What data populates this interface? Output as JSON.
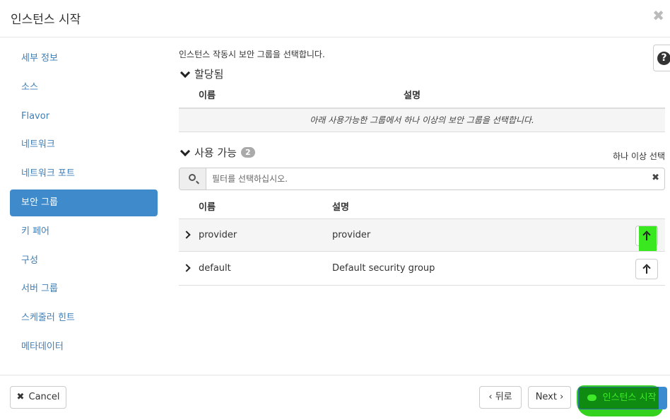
{
  "modal": {
    "title": "인스턴스 시작",
    "close_glyph": "✖"
  },
  "sidebar": {
    "items": [
      {
        "label": "세부 정보"
      },
      {
        "label": "소스"
      },
      {
        "label": "Flavor"
      },
      {
        "label": "네트워크"
      },
      {
        "label": "네트워크 포트"
      },
      {
        "label": "보안 그룹",
        "active": true
      },
      {
        "label": "키 페어"
      },
      {
        "label": "구성"
      },
      {
        "label": "서버 그룹"
      },
      {
        "label": "스케줄러 힌트"
      },
      {
        "label": "메타데이터"
      }
    ]
  },
  "help": {
    "glyph": "?"
  },
  "main": {
    "description": "인스턴스 작동시 보안 그룹을 선택합니다.",
    "allocated": {
      "title": "할당됨",
      "col_name": "이름",
      "col_desc": "설명",
      "empty_text": "아래 사용가능한 그룹에서 하나 이상의 보안 그룹을 선택합니다."
    },
    "available": {
      "title": "사용 가능",
      "count": "2",
      "select_hint": "하나 이상 선택",
      "filter_placeholder": "필터를 선택하십시오.",
      "clear_glyph": "✖",
      "col_name": "이름",
      "col_desc": "설명",
      "rows": [
        {
          "name": "provider",
          "desc": "provider"
        },
        {
          "name": "default",
          "desc": "Default security group"
        }
      ]
    }
  },
  "footer": {
    "cancel_glyph": "✖",
    "cancel_label": "Cancel",
    "back_label": "‹ 뒤로",
    "next_label": "Next ›",
    "launch_label": "인스턴스 시작"
  },
  "colors": {
    "accent": "#3f8acb",
    "link": "#3f7fb8",
    "highlight_green": "#39e81e"
  }
}
